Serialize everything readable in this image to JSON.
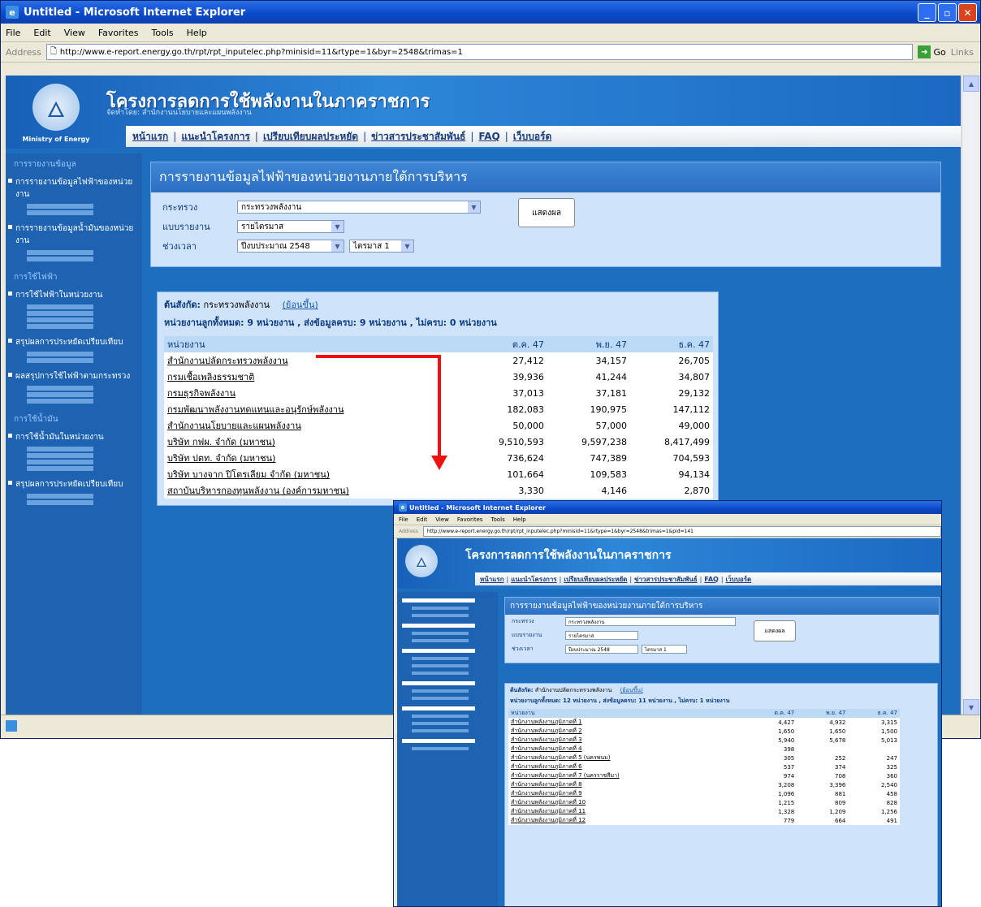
{
  "window": {
    "title": "Untitled - Microsoft Internet Explorer",
    "menu": [
      "File",
      "Edit",
      "View",
      "Favorites",
      "Tools",
      "Help"
    ],
    "address_label": "Address",
    "url": "http://www.e-report.energy.go.th/rpt/rpt_inputelec.php?minisid=11&rtype=1&byr=2548&trimas=1",
    "go_label": "Go",
    "links_label": "Links"
  },
  "site": {
    "title": "โครงการลดการใช้พลังงานในภาคราชการ",
    "subtitle": "จัดทำโดย: สำนักงานนโยบายและแผนพลังงาน",
    "logo_text": "Ministry of Energy",
    "nav": [
      "หน้าแรก",
      "แนะนำโครงการ",
      "เปรียบเทียบผลประหยัด",
      "ข่าวสารประชาสัมพันธ์",
      "FAQ",
      "เว็บบอร์ด"
    ]
  },
  "sidebar": {
    "sec1": "การรายงานข้อมูล",
    "item1": "การรายงานข้อมูลไฟฟ้าของหน่วยงาน",
    "item2": "การรายงานข้อมูลน้ำมันของหน่วยงาน",
    "sec2": "การใช้ไฟฟ้า",
    "item3": "การใช้ไฟฟ้าในหน่วยงาน",
    "item4": "สรุปผลการประหยัดเปรียบเทียบ",
    "item5": "ผลสรุปการใช้ไฟฟ้าตามกระทรวง",
    "sec3": "การใช้น้ำมัน",
    "item6": "การใช้น้ำมันในหน่วยงาน",
    "item7": "สรุปผลการประหยัดเปรียบเทียบ"
  },
  "report": {
    "heading": "การรายงานข้อมูลไฟฟ้าของหน่วยงานภายใต้การบริหาร",
    "label_ministry": "กระทรวง",
    "ministry_value": "กระทรวงพลังงาน",
    "label_type": "แบบรายงาน",
    "type_value": "รายไตรมาส",
    "label_period": "ช่วงเวลา",
    "period_year": "ปีงบประมาณ 2548",
    "period_quarter": "ไตรมาส 1",
    "show_button": "แสดงผล"
  },
  "summary": {
    "agency_label": "ต้นสังกัด:",
    "agency_value": "กระทรวงพลังงาน",
    "more_link": "(ย้อนขึ้น)",
    "count_line": "หน่วยงานลูกทั้งหมด: 9 หน่วยงาน , ส่งข้อมูลครบ: 9 หน่วยงาน , ไม่ครบ: 0 หน่วยงาน"
  },
  "table": {
    "headers": [
      "หน่วยงาน",
      "ต.ค. 47",
      "พ.ย. 47",
      "ธ.ค. 47"
    ],
    "rows": [
      [
        "สำนักงานปลัดกระทรวงพลังงาน",
        "27,412",
        "34,157",
        "26,705"
      ],
      [
        "กรมเชื้อเพลิงธรรมชาติ",
        "39,936",
        "41,244",
        "34,807"
      ],
      [
        "กรมธุรกิจพลังงาน",
        "37,013",
        "37,181",
        "29,132"
      ],
      [
        "กรมพัฒนาพลังงานทดแทนและอนุรักษ์พลังงาน",
        "182,083",
        "190,975",
        "147,112"
      ],
      [
        "สำนักงานนโยบายและแผนพลังงาน",
        "50,000",
        "57,000",
        "49,000"
      ],
      [
        "บริษัท กฟผ. จำกัด (มหาชน)",
        "9,510,593",
        "9,597,238",
        "8,417,499"
      ],
      [
        "บริษัท ปตท. จำกัด (มหาชน)",
        "736,624",
        "747,389",
        "704,593"
      ],
      [
        "บริษัท บางจาก ปิโตรเลียม จำกัด (มหาชน)",
        "101,664",
        "109,583",
        "94,134"
      ],
      [
        "สถาบันบริหารกองทุนพลังงาน (องค์การมหาชน)",
        "3,330",
        "4,146",
        "2,870"
      ]
    ]
  },
  "inset": {
    "title": "Untitled - Microsoft Internet Explorer",
    "url": "http://www.e-report.energy.go.th/rpt/rpt_inputelec.php?minisid=11&rtype=1&byr=2548&trimas=1&pid=141",
    "agency_value": "สำนักงานปลัดกระทรวงพลังงาน",
    "count_line": "หน่วยงานลูกทั้งหมด: 12 หน่วยงาน , ส่งข้อมูลครบ: 11 หน่วยงาน , ไม่ครบ: 1 หน่วยงาน",
    "headers": [
      "หน่วยงาน",
      "ต.ค. 47",
      "พ.ย. 47",
      "ธ.ค. 47"
    ],
    "rows": [
      [
        "สำนักงานพลังงานภูมิภาคที่ 1",
        "4,427",
        "4,932",
        "3,315"
      ],
      [
        "สำนักงานพลังงานภูมิภาคที่ 2",
        "1,650",
        "1,650",
        "1,500"
      ],
      [
        "สำนักงานพลังงานภูมิภาคที่ 3",
        "5,940",
        "5,678",
        "5,013"
      ],
      [
        "สำนักงานพลังงานภูมิภาคที่ 4",
        "398",
        "",
        ""
      ],
      [
        "สำนักงานพลังงานภูมิภาคที่ 5 (นครพนม)",
        "305",
        "252",
        "247"
      ],
      [
        "สำนักงานพลังงานภูมิภาคที่ 6",
        "537",
        "374",
        "325"
      ],
      [
        "สำนักงานพลังงานภูมิภาคที่ 7 (นครราชสีมา)",
        "974",
        "708",
        "360"
      ],
      [
        "สำนักงานพลังงานภูมิภาคที่ 8",
        "3,208",
        "3,396",
        "2,540"
      ],
      [
        "สำนักงานพลังงานภูมิภาคที่ 9",
        "1,096",
        "881",
        "458"
      ],
      [
        "สำนักงานพลังงานภูมิภาคที่ 10",
        "1,215",
        "809",
        "828"
      ],
      [
        "สำนักงานพลังงานภูมิภาคที่ 11",
        "1,328",
        "1,209",
        "1,256"
      ],
      [
        "สำนักงานพลังงานภูมิภาคที่ 12",
        "779",
        "664",
        "491"
      ]
    ]
  },
  "colors": {
    "arrow": "#ee1111",
    "page_bg": "#1e6ec0"
  }
}
